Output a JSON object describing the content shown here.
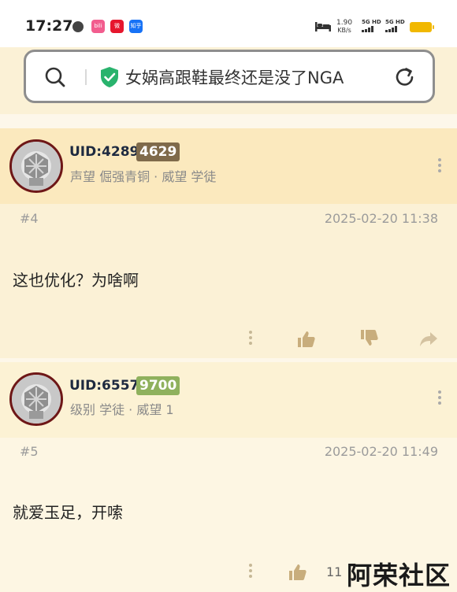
{
  "status_bar": {
    "time": "17:27",
    "apps": [
      {
        "name": "bilibili-app-icon",
        "label": "bili",
        "color": "#f25d8e"
      },
      {
        "name": "weibo-app-icon",
        "label": "微",
        "color": "#e6162d"
      },
      {
        "name": "zhihu-app-icon",
        "label": "知乎",
        "color": "#1772f6"
      }
    ],
    "net_speed": "1.90",
    "net_unit": "KB/s",
    "signal_1_label": "5G HD",
    "signal_2_label": "5G HD",
    "battery_color": "#f1b800"
  },
  "search": {
    "url_text": "女娲高跟鞋最终还是没了NGA"
  },
  "posts": [
    {
      "uid_prefix": "UID:4289",
      "uid_suffix": "4629",
      "uid_suffix_color": "#7f6a4b",
      "meta": "声望 倔强青铜 · 威望 学徒",
      "floor": "#4",
      "time": "2025-02-20 11:38",
      "content": "这也优化？为啥啊"
    },
    {
      "uid_prefix": "UID:6557",
      "uid_suffix": "9700",
      "uid_suffix_color": "#8fb15d",
      "meta": "级别 学徒 · 威望 1",
      "floor": "#5",
      "time": "2025-02-20 11:49",
      "content": "就爱玉足，开嗦",
      "like_count": "11"
    }
  ],
  "watermark": "阿荣社区",
  "colors": {
    "post_header_bg": "#fbe9be",
    "post_body_bg": "#fbf1d6",
    "post2_header_bg": "#fcf2d4",
    "post2_body_bg": "#fdf6e3",
    "action_icon": "#c8ad7c"
  }
}
